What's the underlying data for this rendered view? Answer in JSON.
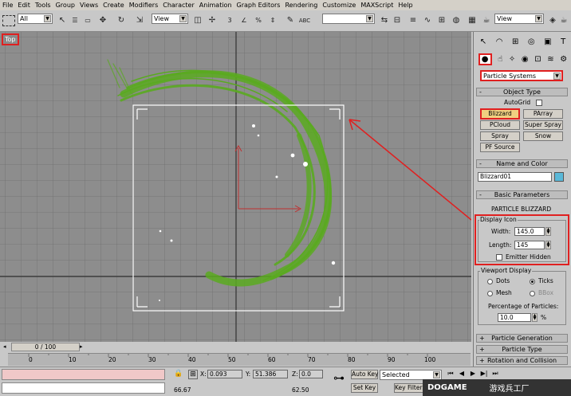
{
  "menu": [
    "File",
    "Edit",
    "Tools",
    "Group",
    "Views",
    "Create",
    "Modifiers",
    "Character",
    "Animation",
    "Graph Editors",
    "Rendering",
    "Customize",
    "MAXScript",
    "Help"
  ],
  "toolbar": {
    "filter_value": "All",
    "view_value": "View",
    "view_value_right": "View"
  },
  "viewport": {
    "label": "Top"
  },
  "command_panel": {
    "category": "Particle Systems",
    "object_type": {
      "header": "Object Type",
      "autogrid": "AutoGrid",
      "buttons": [
        "Blizzard",
        "PArray",
        "PCloud",
        "Super Spray",
        "Spray",
        "Snow",
        "PF Source"
      ]
    },
    "name_and_color": {
      "header": "Name and Color",
      "name": "Blizzard01",
      "color": "#5ab8d8"
    },
    "basic_parameters": {
      "header": "Basic Parameters",
      "title": "PARTICLE BLIZZARD",
      "display_icon": "Display Icon",
      "width_label": "Width:",
      "width_value": "145.0",
      "length_label": "Length:",
      "length_value": "145",
      "emitter_hidden": "Emitter Hidden",
      "viewport_display": "Viewport Display",
      "dots": "Dots",
      "ticks": "Ticks",
      "mesh": "Mesh",
      "bbox": "BBox",
      "percentage_label": "Percentage of Particles:",
      "percentage_value": "10.0",
      "percent_sign": "%"
    },
    "rollouts": [
      "Particle Generation",
      "Particle Type",
      "Rotation and Collision"
    ]
  },
  "timeline": {
    "slider_label": "0 / 100",
    "ticks": [
      "0",
      "10",
      "20",
      "30",
      "40",
      "50",
      "60",
      "70",
      "80",
      "90",
      "100"
    ]
  },
  "status": {
    "x_label": "X:",
    "x_value": "0.093",
    "y_label": "Y:",
    "y_value": "51.386",
    "z_label": "Z:",
    "z_value": "0.0",
    "left_value": "66.67",
    "mid_value": "62.50",
    "autokey": "Auto Key",
    "setkey": "Set Key",
    "selected": "Selected",
    "keyfilters": "Key Filters...",
    "logo_left": "DOGAME",
    "logo_right": "游戏兵工厂"
  },
  "colors": {
    "accent_red": "#e02020",
    "particle_green": "#5aaa20",
    "highlight_yellow": "#f0d080"
  }
}
